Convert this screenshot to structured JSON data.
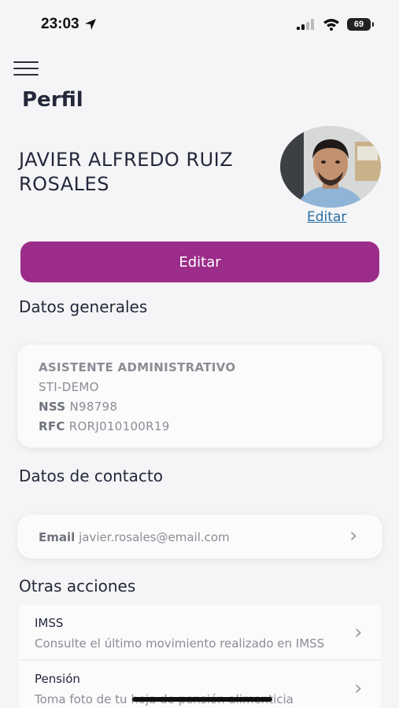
{
  "status": {
    "time": "23:03",
    "battery": "69"
  },
  "header": {
    "title": "Perfil"
  },
  "profile": {
    "name": "JAVIER ALFREDO RUIZ ROSALES",
    "avatar_edit": "Editar",
    "edit_button": "Editar"
  },
  "general": {
    "title": "Datos generales",
    "position": "ASISTENTE ADMINISTRATIVO",
    "company": "STI-DEMO",
    "nss_label": "NSS",
    "nss_value": "N98798",
    "rfc_label": "RFC",
    "rfc_value": "RORJ010100R19"
  },
  "contact": {
    "title": "Datos de contacto",
    "email_label": "Email",
    "email_value": "javier.rosales@email.com"
  },
  "actions": {
    "title": "Otras acciones",
    "items": [
      {
        "title": "IMSS",
        "description": "Consulte el último movimiento realizado en IMSS"
      },
      {
        "title": "Pensión",
        "description": "Toma foto de tu hoja de pensión alimenticia"
      }
    ]
  },
  "colors": {
    "primary": "#9b2c89",
    "link": "#2a6ea3",
    "background": "#f5f5f7"
  }
}
